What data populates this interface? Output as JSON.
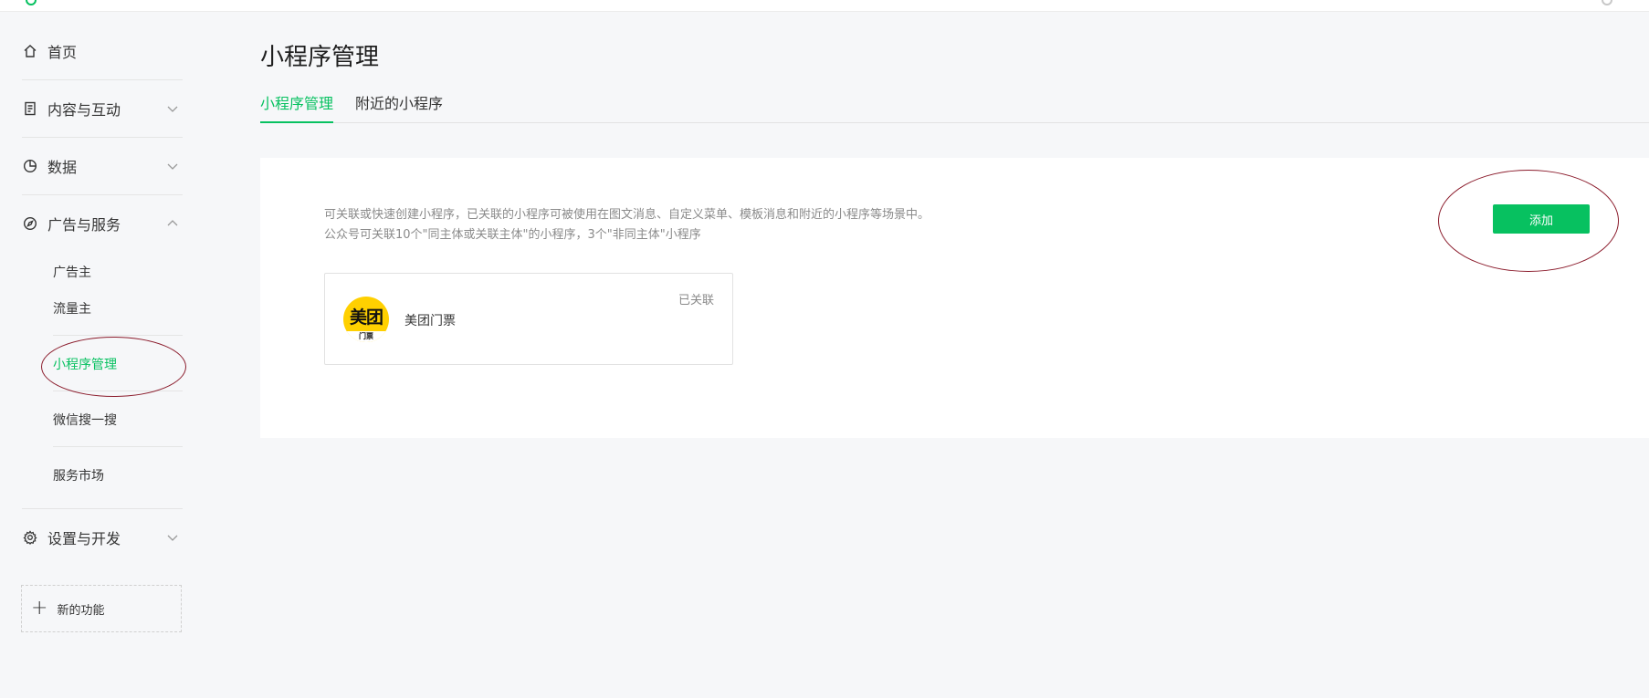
{
  "sidebar": {
    "home": "首页",
    "content": "内容与互动",
    "data": "数据",
    "ads": "广告与服务",
    "ads_items": [
      "广告主",
      "流量主",
      "小程序管理",
      "微信搜一搜",
      "服务市场"
    ],
    "settings": "设置与开发",
    "new_feature": "新的功能"
  },
  "main": {
    "title": "小程序管理",
    "tabs": [
      "小程序管理",
      "附近的小程序"
    ],
    "description_line1": "可关联或快速创建小程序，已关联的小程序可被使用在图文消息、自定义菜单、模板消息和附近的小程序等场景中。",
    "description_line2": "公众号可关联10个\"同主体或关联主体\"的小程序，3个\"非同主体\"小程序",
    "add_button": "添加",
    "linked_apps": [
      {
        "name": "美团门票",
        "status": "已关联",
        "logo_main": "美团",
        "logo_sub": "门票"
      }
    ]
  },
  "colors": {
    "accent": "#07c160",
    "annotation": "#8b1c2c",
    "logo_bg": "#ffd000"
  },
  "icons": {
    "home": "home-icon",
    "content": "document-icon",
    "data": "pie-chart-icon",
    "ads": "compass-icon",
    "settings": "gear-icon",
    "chevron": "chevron-icon",
    "plus": "plus-icon"
  }
}
